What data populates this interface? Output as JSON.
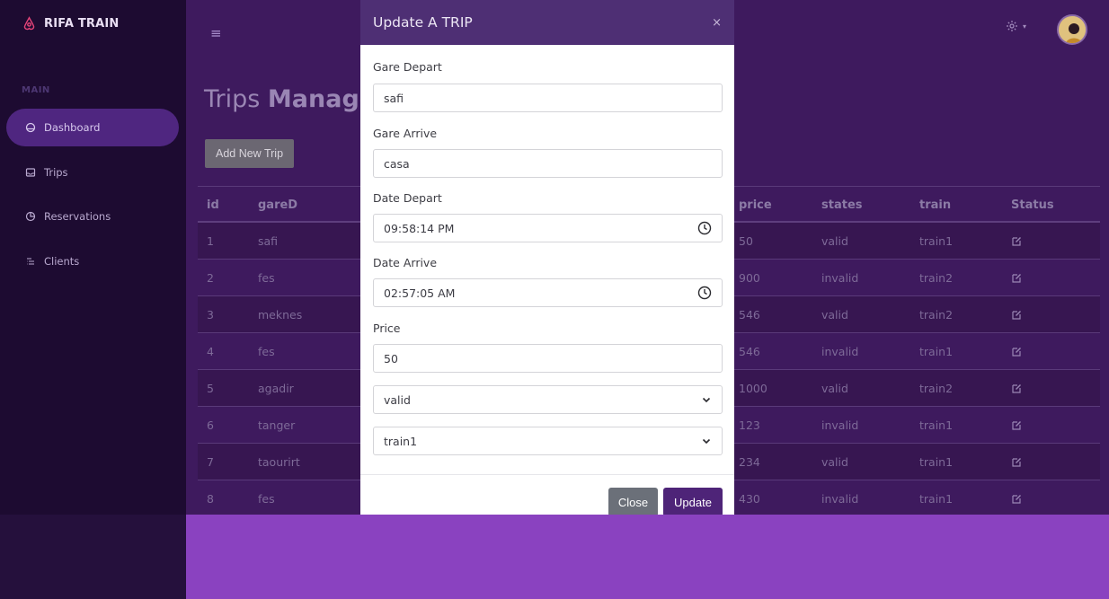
{
  "brand": {
    "name": "RIFA TRAIN"
  },
  "sidebar": {
    "section": "MAIN",
    "items": [
      {
        "label": "Dashboard",
        "icon": "dashboard-icon",
        "active": true
      },
      {
        "label": "Trips",
        "icon": "inbox-icon"
      },
      {
        "label": "Reservations",
        "icon": "pie-chart-icon"
      },
      {
        "label": "Clients",
        "icon": "list-icon"
      }
    ]
  },
  "header": {
    "menu_icon": "≡",
    "settings_icon": "gear-icon",
    "caret": "▾"
  },
  "page": {
    "title_light": "Trips ",
    "title_bold": "Manager",
    "add_button": "Add New Trip"
  },
  "table": {
    "columns": {
      "id": "id",
      "gare": "gareD",
      "price": "price",
      "states": "states",
      "train": "train",
      "status": "Status"
    },
    "rows": [
      {
        "id": "1",
        "gare": "safi",
        "price": "50",
        "states": "valid",
        "train": "train1"
      },
      {
        "id": "2",
        "gare": "fes",
        "price": "900",
        "states": "invalid",
        "train": "train2"
      },
      {
        "id": "3",
        "gare": "meknes",
        "price": "546",
        "states": "valid",
        "train": "train2"
      },
      {
        "id": "4",
        "gare": "fes",
        "price": "546",
        "states": "invalid",
        "train": "train1"
      },
      {
        "id": "5",
        "gare": "agadir",
        "price": "1000",
        "states": "valid",
        "train": "train2"
      },
      {
        "id": "6",
        "gare": "tanger",
        "price": "123",
        "states": "invalid",
        "train": "train1"
      },
      {
        "id": "7",
        "gare": "taourirt",
        "price": "234",
        "states": "valid",
        "train": "train1"
      },
      {
        "id": "8",
        "gare": "fes",
        "price": "430",
        "states": "invalid",
        "train": "train1"
      }
    ]
  },
  "modal": {
    "title": "Update A TRIP",
    "close_symbol": "×",
    "fields": {
      "gare_depart": {
        "label": "Gare Depart",
        "value": "safi"
      },
      "gare_arrive": {
        "label": "Gare Arrive",
        "value": "casa"
      },
      "date_depart": {
        "label": "Date Depart",
        "value": "09:58:14 PM"
      },
      "date_arrive": {
        "label": "Date Arrive",
        "value": "02:57:05 AM"
      },
      "price": {
        "label": "Price",
        "value": "50"
      },
      "state_select": {
        "value": "valid"
      },
      "train_select": {
        "value": "train1"
      }
    },
    "buttons": {
      "close": "Close",
      "update": "Update"
    }
  },
  "colors": {
    "sidebar": "#1d0b31",
    "main_bg": "#3e1a5e",
    "modal_header": "#4e2f74",
    "update_button": "#4e2478",
    "bottom_bg": "#8a42c0"
  }
}
